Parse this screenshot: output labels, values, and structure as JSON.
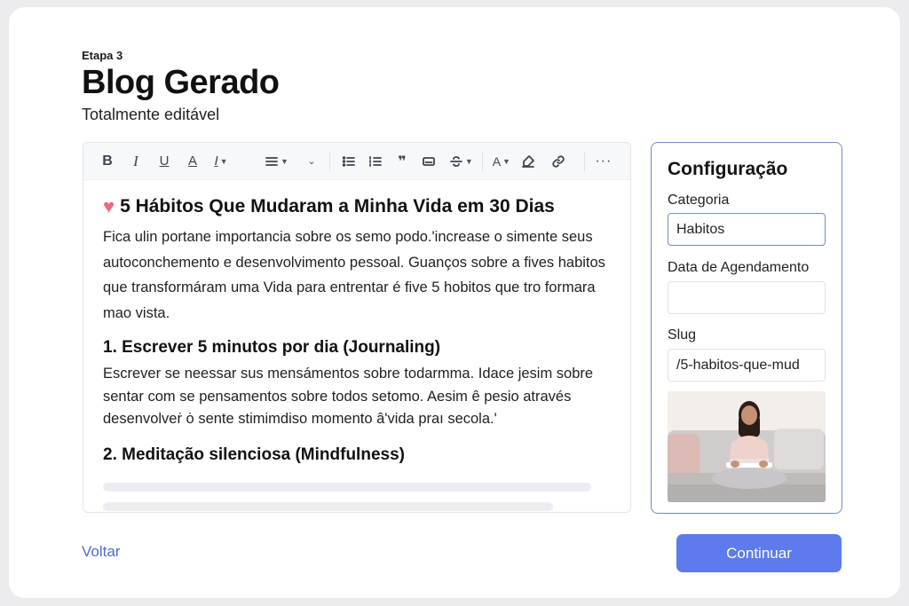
{
  "header": {
    "step": "Etapa 3",
    "title": "Blog Gerado",
    "subtitle": "Totalmente editável"
  },
  "toolbar": {
    "bold": "B",
    "italic": "I",
    "underline": "U",
    "font_color": "A",
    "clear_format": "I",
    "text_size": "A"
  },
  "post": {
    "title": "5 Hábitos Que Mudaram a Minha Vida em 30 Dias",
    "intro": "Fica ulin portane importancia sobre os semo podo.'increase o simente seus autoconchemento e desenvolvimento pessoal. Guanços sobre a fives habitos que transformáram uma Vida para entrentar é five 5 hobitos que tro formara mao vista.",
    "section1_heading": "1. Escrever 5 minutos por dia (Journaling)",
    "section1_body": "Escrever se neessar sus mensámentos sobre todarmma. Idace jesim sobre sentar com se pensamentos sobre todos setomo. Aesim ê pesio através desenvolveṙ ȯ sente stimimdiso momento â'vida praı secola.'",
    "section2_heading": "2. Meditação silenciosa (Mindfulness)"
  },
  "config": {
    "title": "Configuração",
    "category_label": "Categoria",
    "category_value": "Habitos",
    "schedule_label": "Data de Agendamento",
    "schedule_value": "",
    "slug_label": "Slug",
    "slug_value": "/5-habitos-que-mud"
  },
  "actions": {
    "back": "Voltar",
    "continue": "Continuar"
  },
  "colors": {
    "accent": "#5d7bec",
    "link": "#4d6fc4",
    "panel_border": "#6f8cbf",
    "heart": "#ec6b80"
  }
}
